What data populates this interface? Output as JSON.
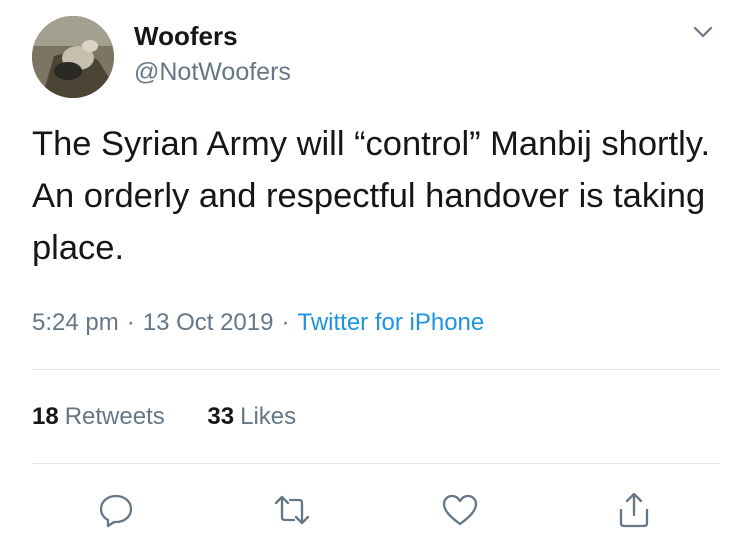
{
  "tweet": {
    "author": {
      "display_name": "Woofers",
      "handle": "@NotWoofers"
    },
    "text": "The Syrian Army will “control” Manbij shortly. An orderly and respectful handover is taking place.",
    "meta": {
      "time": "5:24 pm",
      "separator": "·",
      "date": "13 Oct 2019",
      "source": "Twitter for iPhone"
    },
    "stats": {
      "retweets_count": "18",
      "retweets_label": "Retweets",
      "likes_count": "33",
      "likes_label": "Likes"
    },
    "actions": [
      "reply-icon",
      "retweet-icon",
      "like-icon",
      "share-icon"
    ]
  },
  "colors": {
    "text_primary": "#14171a",
    "text_secondary": "#657786",
    "link": "#1b95e0",
    "divider": "#dfe3e6",
    "icon": "#657786"
  }
}
